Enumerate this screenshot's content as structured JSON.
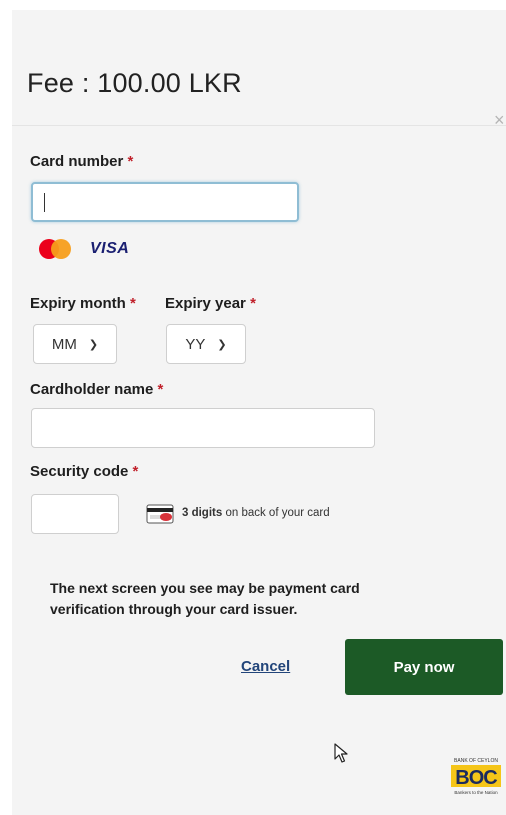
{
  "header": {
    "fee_text": "Fee : 100.00 LKR",
    "close_glyph": "×"
  },
  "form": {
    "required_mark": "*",
    "card_number": {
      "label": "Card number",
      "value": "",
      "placeholder": ""
    },
    "card_brands": [
      {
        "name": "mastercard-logo"
      },
      {
        "name": "visa-logo",
        "text": "VISA"
      }
    ],
    "expiry_month": {
      "label": "Expiry month",
      "selected": "MM"
    },
    "expiry_year": {
      "label": "Expiry year",
      "selected": "YY"
    },
    "cardholder_name": {
      "label": "Cardholder name",
      "value": ""
    },
    "security_code": {
      "label": "Security code",
      "value": "",
      "hint_bold": "3 digits",
      "hint_rest": " on back of your card"
    }
  },
  "notice": "The next screen you see may be payment card verification through your card issuer.",
  "actions": {
    "cancel_label": "Cancel",
    "pay_label": "Pay now"
  },
  "footer": {
    "logo_name": "bank-of-ceylon-logo",
    "logo_top": "BANK OF CEYLON",
    "logo_mark": "BOC",
    "logo_tagline": "Bankers to the Nation"
  },
  "colors": {
    "primary_button": "#1c5a26",
    "link": "#22457a",
    "required": "#c0202a",
    "focus_border": "#8fbdd4"
  }
}
